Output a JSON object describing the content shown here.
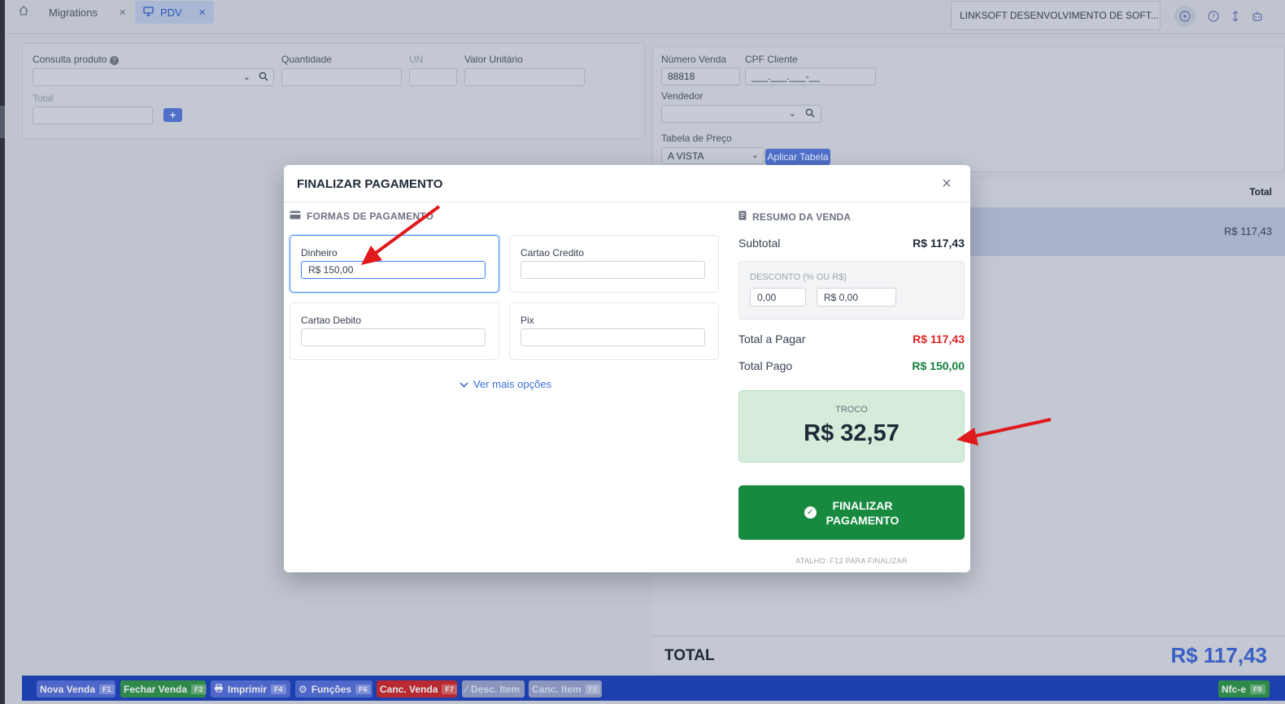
{
  "tabs": [
    {
      "label": "Migrations"
    },
    {
      "label": "PDV"
    }
  ],
  "header": {
    "company": "LINKSOFT DESENVOLVIMENTO DE SOFT..."
  },
  "product_panel": {
    "consulta_label": "Consulta produto",
    "quantidade_label": "Quantidade",
    "un_label": "UN",
    "valor_unitario_label": "Valor Unitário",
    "total_label": "Total",
    "add_label": "+"
  },
  "sale_panel": {
    "numero_venda_label": "Número Venda",
    "numero_venda_value": "88818",
    "cpf_label": "CPF Cliente",
    "cpf_value": "___.___.___-__",
    "vendedor_label": "Vendedor",
    "tabela_label": "Tabela de Preço",
    "tabela_value": "A VISTA",
    "aplicar_label": "Aplicar Tabela"
  },
  "items_list": {
    "total_header": "Total",
    "rows": [
      {
        "total": "R$ 117,43"
      }
    ]
  },
  "grand_total": {
    "label": "TOTAL",
    "value": "R$ 117,43"
  },
  "shortcuts": [
    {
      "label": "Nova Venda",
      "key": "F1"
    },
    {
      "label": "Fechar Venda",
      "key": "F2"
    },
    {
      "label": "Imprimir",
      "key": "F4"
    },
    {
      "label": "Funções",
      "key": "F6"
    },
    {
      "label": "Canc. Venda",
      "key": "F7"
    },
    {
      "label": "Desc. Item",
      "key": ""
    },
    {
      "label": "Canc. Item",
      "key": "F8"
    },
    {
      "label": "Nfc-e",
      "key": "F9"
    }
  ],
  "modal": {
    "title": "FINALIZAR PAGAMENTO",
    "formas_title": "FORMAS DE PAGAMENTO",
    "methods": [
      {
        "label": "Dinheiro",
        "value": "R$ 150,00"
      },
      {
        "label": "Cartao Credito",
        "value": ""
      },
      {
        "label": "Cartao Debito",
        "value": ""
      },
      {
        "label": "Pix",
        "value": ""
      }
    ],
    "more_options": "Ver mais opções",
    "resumo_title": "RESUMO DA VENDA",
    "subtotal_label": "Subtotal",
    "subtotal_value": "R$ 117,43",
    "desconto_label": "DESCONTO (% OU R$)",
    "desconto_pct": "0,00",
    "desconto_val": "R$ 0,00",
    "total_pagar_label": "Total a Pagar",
    "total_pagar_value": "R$ 117,43",
    "total_pago_label": "Total Pago",
    "total_pago_value": "R$ 150,00",
    "troco_label": "TROCO",
    "troco_value": "R$ 32,57",
    "finalizar_line1": "FINALIZAR",
    "finalizar_line2": "PAGAMENTO",
    "atalho": "ATALHO: F12 PARA FINALIZAR"
  },
  "colors": {
    "accent_blue": "#3b82f6",
    "finalize_green": "#188a40",
    "total_red": "#dc2626",
    "paid_green": "#15803d"
  }
}
